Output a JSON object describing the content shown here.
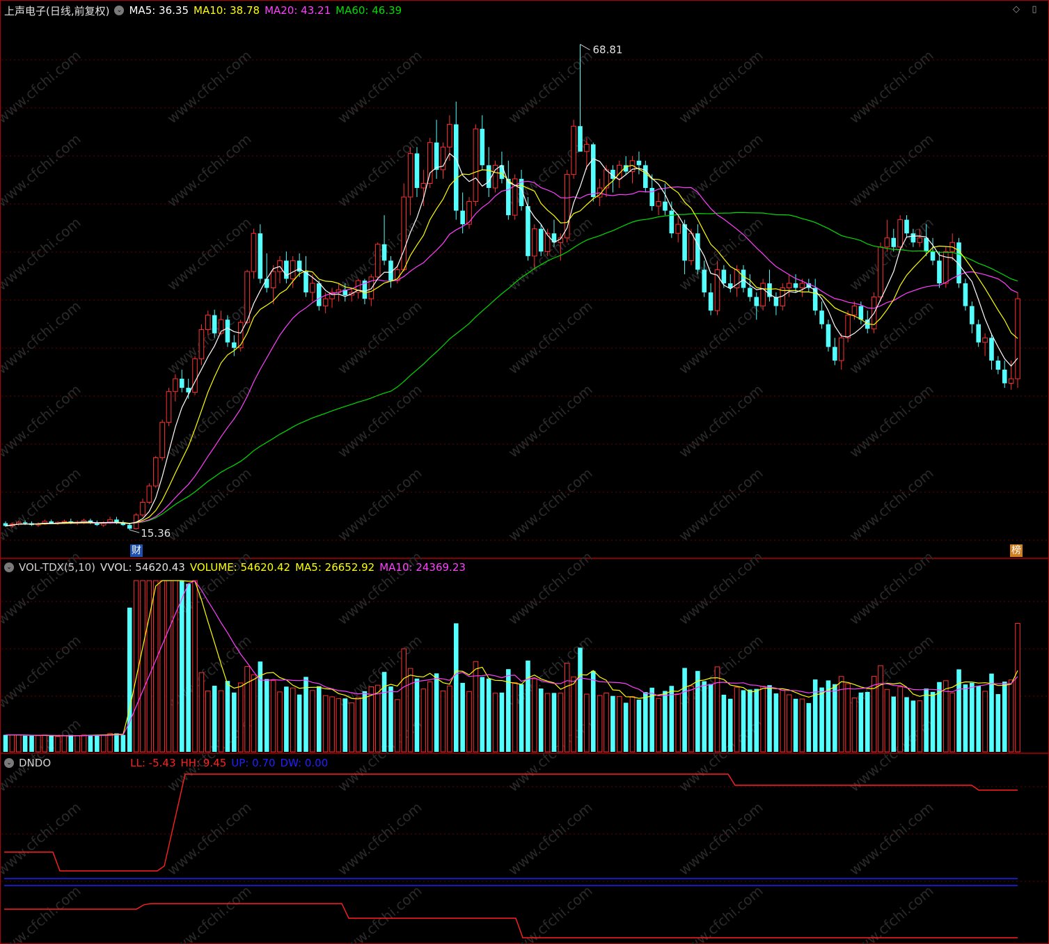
{
  "colors": {
    "up": "#ff3030",
    "down": "#54ffff",
    "ma5": "#ffffff",
    "ma10": "#ffff00",
    "ma20": "#ff40ff",
    "ma60": "#00dd00",
    "grid": "#6a0000",
    "border": "#b00000",
    "ll": "#ff2020",
    "hh": "#ff2020",
    "up_line": "#2020ff",
    "dw_line": "#2020ff"
  },
  "price_panel": {
    "title": "上声电子(日线,前复权)",
    "ma5": "MA5: 36.35",
    "ma10": "MA10: 38.78",
    "ma20": "MA20: 43.21",
    "ma60": "MA60: 46.39",
    "high_label": "68.81",
    "low_label": "15.36",
    "badge_left": "财",
    "badge_right": "榜"
  },
  "volume_panel": {
    "name": "VOL-TDX(5,10)",
    "vvol": "VVOL: 54620.43",
    "volume": "VOLUME: 54620.42",
    "ma5": "MA5: 26652.92",
    "ma10": "MA10: 24369.23"
  },
  "indicator_panel": {
    "name": "DNDO",
    "ll": "LL: -5.43",
    "hh": "HH: 9.45",
    "up": "UP: 0.70",
    "dw": "DW: 0.00"
  },
  "watermark": "www.cfchi.com",
  "chart_data": {
    "type": "candlestick",
    "price_range": [
      13,
      72
    ],
    "candles": [
      [
        16.1,
        16.3,
        15.7,
        15.8
      ],
      [
        15.8,
        16.2,
        15.6,
        16.0
      ],
      [
        16.0,
        16.4,
        15.8,
        16.2
      ],
      [
        16.2,
        16.4,
        15.9,
        16.1
      ],
      [
        16.1,
        16.3,
        15.8,
        15.9
      ],
      [
        15.9,
        16.2,
        15.7,
        16.0
      ],
      [
        16.0,
        16.5,
        15.9,
        16.3
      ],
      [
        16.3,
        16.5,
        16.0,
        16.1
      ],
      [
        16.1,
        16.3,
        15.9,
        16.2
      ],
      [
        16.2,
        16.5,
        16.0,
        16.3
      ],
      [
        16.3,
        16.6,
        16.0,
        16.1
      ],
      [
        16.1,
        16.4,
        15.9,
        16.2
      ],
      [
        16.2,
        16.6,
        16.0,
        16.4
      ],
      [
        16.4,
        16.6,
        16.0,
        16.1
      ],
      [
        16.1,
        16.4,
        15.8,
        15.9
      ],
      [
        15.9,
        16.3,
        15.7,
        16.1
      ],
      [
        16.1,
        16.8,
        16.0,
        16.5
      ],
      [
        16.5,
        16.8,
        16.0,
        16.2
      ],
      [
        16.2,
        16.4,
        15.8,
        15.9
      ],
      [
        15.9,
        16.1,
        15.36,
        15.5
      ],
      [
        15.5,
        17.2,
        15.4,
        17.0
      ],
      [
        17.0,
        18.8,
        16.8,
        18.4
      ],
      [
        18.4,
        20.5,
        18.2,
        20.2
      ],
      [
        20.2,
        23.5,
        20.0,
        23.3
      ],
      [
        23.3,
        27.5,
        23.0,
        27.2
      ],
      [
        27.2,
        31.0,
        26.8,
        30.6
      ],
      [
        30.6,
        32.5,
        29.5,
        32.0
      ],
      [
        32.0,
        33.0,
        30.5,
        31.0
      ],
      [
        31.0,
        32.0,
        29.8,
        30.5
      ],
      [
        30.5,
        34.5,
        30.2,
        34.2
      ],
      [
        34.2,
        38.0,
        33.5,
        37.4
      ],
      [
        37.4,
        39.5,
        36.8,
        39.0
      ],
      [
        39.0,
        39.6,
        36.5,
        37.0
      ],
      [
        37.0,
        39.5,
        36.8,
        38.5
      ],
      [
        38.5,
        39.0,
        35.5,
        36.0
      ],
      [
        36.0,
        36.8,
        34.5,
        35.4
      ],
      [
        35.4,
        38.5,
        35.0,
        38.2
      ],
      [
        38.2,
        44.0,
        38.0,
        43.8
      ],
      [
        43.8,
        48.5,
        43.0,
        48.0
      ],
      [
        48.0,
        49.0,
        42.5,
        43.0
      ],
      [
        43.0,
        45.8,
        41.5,
        42.0
      ],
      [
        42.0,
        44.5,
        40.2,
        43.8
      ],
      [
        43.8,
        45.5,
        42.5,
        45.0
      ],
      [
        45.0,
        46.0,
        42.5,
        43.0
      ],
      [
        43.0,
        45.5,
        42.0,
        45.0
      ],
      [
        45.0,
        45.8,
        43.2,
        43.8
      ],
      [
        43.8,
        45.5,
        41.0,
        41.5
      ],
      [
        41.5,
        43.5,
        40.5,
        42.5
      ],
      [
        42.5,
        42.8,
        39.5,
        40.0
      ],
      [
        40.0,
        41.5,
        39.2,
        40.8
      ],
      [
        40.8,
        42.0,
        39.8,
        41.5
      ],
      [
        41.5,
        42.5,
        40.5,
        41.8
      ],
      [
        41.8,
        42.5,
        40.5,
        41.2
      ],
      [
        41.2,
        42.0,
        40.5,
        41.5
      ],
      [
        41.5,
        43.0,
        40.8,
        42.8
      ],
      [
        42.8,
        43.0,
        40.2,
        40.8
      ],
      [
        40.8,
        43.5,
        40.0,
        43.2
      ],
      [
        43.2,
        47.0,
        43.0,
        46.8
      ],
      [
        46.8,
        50.0,
        44.5,
        45.0
      ],
      [
        45.0,
        45.5,
        42.0,
        42.8
      ],
      [
        42.8,
        44.5,
        42.5,
        44.0
      ],
      [
        44.0,
        53.5,
        43.8,
        52.0
      ],
      [
        52.0,
        57.5,
        50.0,
        56.8
      ],
      [
        56.8,
        57.5,
        52.0,
        53.0
      ],
      [
        53.0,
        55.0,
        51.0,
        53.5
      ],
      [
        53.5,
        58.5,
        53.0,
        58.0
      ],
      [
        58.0,
        60.5,
        54.0,
        55.0
      ],
      [
        55.0,
        58.0,
        54.0,
        57.5
      ],
      [
        57.5,
        61.0,
        56.0,
        60.0
      ],
      [
        60.0,
        62.5,
        49.5,
        50.5
      ],
      [
        50.5,
        52.5,
        48.0,
        49.0
      ],
      [
        49.0,
        52.0,
        48.5,
        51.5
      ],
      [
        51.5,
        60.0,
        51.0,
        59.5
      ],
      [
        59.5,
        61.0,
        55.0,
        55.5
      ],
      [
        55.5,
        57.5,
        52.0,
        53.0
      ],
      [
        53.0,
        56.0,
        52.5,
        55.5
      ],
      [
        55.5,
        57.0,
        53.5,
        54.0
      ],
      [
        54.0,
        56.0,
        49.5,
        50.0
      ],
      [
        50.0,
        54.5,
        49.5,
        54.0
      ],
      [
        54.0,
        55.0,
        50.5,
        51.0
      ],
      [
        51.0,
        52.0,
        45.0,
        45.5
      ],
      [
        45.5,
        49.0,
        44.0,
        48.5
      ],
      [
        48.5,
        49.0,
        45.5,
        46.0
      ],
      [
        46.0,
        48.5,
        45.5,
        48.0
      ],
      [
        48.0,
        49.5,
        46.5,
        47.0
      ],
      [
        47.0,
        48.0,
        45.0,
        47.5
      ],
      [
        47.5,
        55.0,
        47.0,
        54.5
      ],
      [
        54.5,
        60.5,
        54.0,
        59.8
      ],
      [
        59.8,
        68.81,
        58.0,
        57.0
      ],
      [
        57.0,
        58.5,
        55.0,
        57.8
      ],
      [
        57.8,
        58.0,
        51.5,
        52.0
      ],
      [
        52.0,
        54.0,
        51.0,
        53.0
      ],
      [
        53.0,
        55.5,
        52.0,
        55.0
      ],
      [
        55.0,
        55.5,
        52.5,
        54.0
      ],
      [
        54.0,
        56.0,
        53.0,
        55.5
      ],
      [
        55.5,
        56.5,
        54.5,
        54.8
      ],
      [
        54.8,
        56.5,
        53.5,
        56.0
      ],
      [
        56.0,
        57.0,
        54.5,
        55.5
      ],
      [
        55.5,
        56.0,
        52.5,
        53.0
      ],
      [
        53.0,
        54.5,
        50.5,
        51.0
      ],
      [
        51.0,
        52.5,
        50.0,
        51.5
      ],
      [
        51.5,
        53.5,
        50.0,
        50.5
      ],
      [
        50.5,
        51.5,
        47.5,
        48.0
      ],
      [
        48.0,
        50.0,
        47.0,
        49.0
      ],
      [
        49.0,
        49.5,
        43.5,
        45.0
      ],
      [
        45.0,
        48.5,
        44.5,
        48.0
      ],
      [
        48.0,
        49.0,
        43.5,
        44.0
      ],
      [
        44.0,
        45.0,
        41.0,
        41.5
      ],
      [
        41.5,
        42.5,
        39.0,
        39.5
      ],
      [
        39.5,
        45.0,
        39.0,
        44.0
      ],
      [
        44.0,
        44.5,
        42.0,
        42.5
      ],
      [
        42.5,
        43.5,
        41.5,
        42.0
      ],
      [
        42.0,
        44.5,
        41.0,
        44.0
      ],
      [
        44.0,
        44.5,
        41.5,
        42.0
      ],
      [
        42.0,
        43.5,
        40.5,
        41.0
      ],
      [
        41.0,
        41.5,
        38.5,
        40.0
      ],
      [
        40.0,
        43.0,
        39.5,
        42.5
      ],
      [
        42.5,
        44.0,
        40.5,
        41.0
      ],
      [
        41.0,
        41.5,
        39.0,
        40.0
      ],
      [
        40.0,
        42.5,
        39.5,
        42.0
      ],
      [
        42.0,
        43.5,
        41.0,
        42.5
      ],
      [
        42.5,
        43.5,
        41.5,
        42.0
      ],
      [
        42.0,
        43.0,
        41.0,
        42.5
      ],
      [
        42.5,
        43.0,
        41.5,
        42.0
      ],
      [
        42.0,
        43.0,
        39.0,
        39.5
      ],
      [
        39.5,
        40.5,
        37.5,
        38.0
      ],
      [
        38.0,
        38.5,
        35.0,
        35.5
      ],
      [
        35.5,
        36.5,
        33.5,
        34.0
      ],
      [
        34.0,
        37.0,
        33.0,
        36.5
      ],
      [
        36.5,
        39.5,
        36.0,
        39.0
      ],
      [
        39.0,
        40.5,
        38.5,
        40.0
      ],
      [
        40.0,
        40.5,
        38.0,
        38.5
      ],
      [
        38.5,
        39.5,
        37.0,
        37.5
      ],
      [
        37.5,
        41.5,
        37.0,
        41.0
      ],
      [
        41.0,
        47.0,
        40.5,
        46.5
      ],
      [
        46.5,
        49.5,
        46.0,
        47.5
      ],
      [
        47.5,
        48.5,
        46.0,
        46.5
      ],
      [
        46.5,
        50.0,
        46.0,
        49.5
      ],
      [
        49.5,
        50.0,
        47.5,
        48.0
      ],
      [
        48.0,
        48.5,
        46.5,
        47.0
      ],
      [
        47.0,
        48.5,
        46.5,
        47.5
      ],
      [
        47.5,
        49.0,
        45.5,
        46.0
      ],
      [
        46.0,
        47.5,
        44.5,
        45.0
      ],
      [
        45.0,
        46.0,
        42.0,
        42.5
      ],
      [
        42.5,
        46.5,
        42.0,
        46.0
      ],
      [
        46.0,
        48.0,
        45.0,
        47.0
      ],
      [
        47.0,
        47.5,
        42.0,
        42.5
      ],
      [
        42.5,
        43.0,
        39.5,
        40.0
      ],
      [
        40.0,
        40.5,
        37.0,
        38.0
      ],
      [
        38.0,
        38.5,
        35.5,
        36.0
      ],
      [
        36.0,
        37.0,
        34.5,
        36.5
      ],
      [
        36.5,
        37.0,
        33.0,
        34.0
      ],
      [
        34.0,
        34.5,
        32.5,
        33.0
      ],
      [
        33.0,
        34.0,
        31.0,
        31.5
      ],
      [
        31.5,
        34.0,
        30.8,
        32.0
      ],
      [
        32.0,
        41.5,
        31.0,
        40.8
      ]
    ]
  }
}
